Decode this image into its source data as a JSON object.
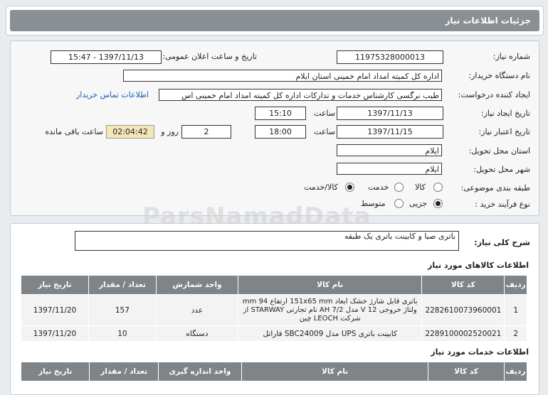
{
  "header": {
    "title": "جزئیات اطلاعات نیاز"
  },
  "form": {
    "need_number_label": "شماره نیاز:",
    "need_number": "11975328000013",
    "announce_label": "تاریخ و ساعت اعلان عمومی:",
    "announce_value": "1397/11/13 - 15:47",
    "buyer_label": "نام دستگاه خریدار:",
    "buyer_value": "اداره کل کمیته امداد امام خمینی استان ایلام",
    "creator_label": "ایجاد کننده درخواست:",
    "creator_value": "طیب نرگسی کارشناس خدمات و تدارکات اداره کل کمیته امداد امام خمینی اس",
    "contact_link": "اطلاعات تماس خریدار",
    "create_date_label": "تاریخ ایجاد نیاز:",
    "create_date": "1397/11/13",
    "time_label": "ساعت",
    "create_time": "15:10",
    "validity_label": "تاریخ اعتبار نیاز:",
    "validity_date": "1397/11/15",
    "validity_time": "18:00",
    "days_value": "2",
    "days_label": "روز و",
    "remaining_value": "02:04:42",
    "remaining_label": "ساعت باقی مانده",
    "province_label": "استان محل تحویل:",
    "province_value": "ایلام",
    "city_label": "شهر محل تحویل:",
    "city_value": "ایلام",
    "category_label": "طبقه بندی موضوعی:",
    "category_options": [
      "کالا",
      "خدمت",
      "کالا/خدمت"
    ],
    "category_selected": "کالا/خدمت",
    "process_label": "نوع فرآیند خرید :",
    "process_options": [
      "جزیی",
      "متوسط"
    ],
    "process_selected": "جزیی"
  },
  "description": {
    "label": "شرح کلی نیاز:",
    "value": "باتری صبا و کابینت باتری یک طبقه"
  },
  "goods": {
    "section_title": "اطلاعات کالاهای مورد نیاز",
    "columns": [
      "ردیف",
      "کد کالا",
      "نام کالا",
      "واحد شمارش",
      "تعداد / مقدار",
      "تاریخ نیاز"
    ],
    "rows": [
      {
        "row": "1",
        "code": "2282610073960001",
        "name": "باتری قابل شارژ خشک ابعاد 151x65 mm ارتفاع 94 mm ولتاژ خروجی 12 V مدل 7/2 AH نام تجارتی STARWAY از شرکت LEOCH چین",
        "unit": "عدد",
        "qty": "157",
        "date": "1397/11/20"
      },
      {
        "row": "2",
        "code": "2289100002520021",
        "name": "کابینت باتری UPS مدل SBC24009 فاراتل",
        "unit": "دستگاه",
        "qty": "10",
        "date": "1397/11/20"
      }
    ]
  },
  "services": {
    "section_title": "اطلاعات خدمات مورد نیاز",
    "columns": [
      "ردیف",
      "کد کالا",
      "نام کالا",
      "واحد اندازه گیری",
      "تعداد / مقدار",
      "تاریخ نیاز"
    ]
  },
  "watermark": "ParsNamadData"
}
